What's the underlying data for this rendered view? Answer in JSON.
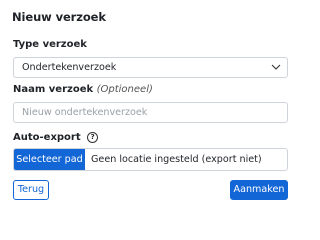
{
  "dialog": {
    "title": "Nieuw verzoek",
    "type": {
      "label": "Type verzoek",
      "selected": "Ondertekenverzoek"
    },
    "name": {
      "label": "Naam verzoek",
      "optional": "(Optioneel)",
      "placeholder": "Nieuw ondertekenverzoek"
    },
    "auto_export": {
      "label": "Auto-export",
      "help_icon": "?",
      "button": "Selecteer pad",
      "status": "Geen locatie ingesteld (export niet)"
    },
    "actions": {
      "back": "Terug",
      "create": "Aanmaken"
    }
  },
  "colors": {
    "accent": "#1366d6",
    "border": "#cfd4da"
  },
  "icons": [
    "chevron-down-icon",
    "help-circle-icon"
  ]
}
